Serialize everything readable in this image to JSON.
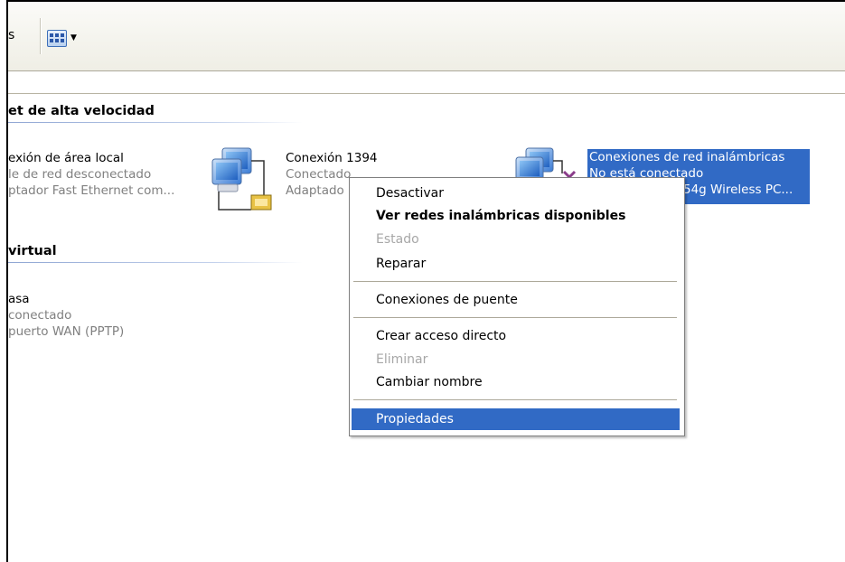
{
  "toolbar": {
    "trailing_text": "s",
    "views_button": {
      "icon": "views-icon",
      "arrow_icon": "dropdown-arrow-icon"
    }
  },
  "groups": {
    "highspeed": {
      "heading": "et de alta velocidad"
    },
    "virtual": {
      "heading": "virtual"
    }
  },
  "connections": [
    {
      "name": "exión de área local",
      "status": "le de red desconectado",
      "device": "ptador Fast Ethernet com..."
    },
    {
      "name": "Conexión 1394",
      "status": "Conectado",
      "device": "Adaptado",
      "icon": "network-connection-icon"
    },
    {
      "name": "Conexiones de red inalámbricas",
      "status": "No está conectado",
      "device": "54g Wireless PC...",
      "icon": "wireless-connection-disconnected-icon",
      "selected": true
    },
    {
      "name": "asa",
      "status": "conectado",
      "device": "puerto WAN (PPTP)"
    }
  ],
  "context_menu": {
    "items": [
      {
        "label": "Desactivar",
        "state": "normal"
      },
      {
        "label": "Ver redes inalámbricas disponibles",
        "state": "default-bold"
      },
      {
        "label": "Estado",
        "state": "disabled"
      },
      {
        "label": "Reparar",
        "state": "normal"
      },
      {
        "label": "Conexiones de puente",
        "state": "normal"
      },
      {
        "label": "Crear acceso directo",
        "state": "normal"
      },
      {
        "label": "Eliminar",
        "state": "disabled"
      },
      {
        "label": "Cambiar nombre",
        "state": "normal"
      },
      {
        "label": "Propiedades",
        "state": "highlighted"
      }
    ]
  },
  "colors": {
    "selection": "#316ac5",
    "disabled_text": "#a7a7a7",
    "secondary_text": "#808080"
  }
}
